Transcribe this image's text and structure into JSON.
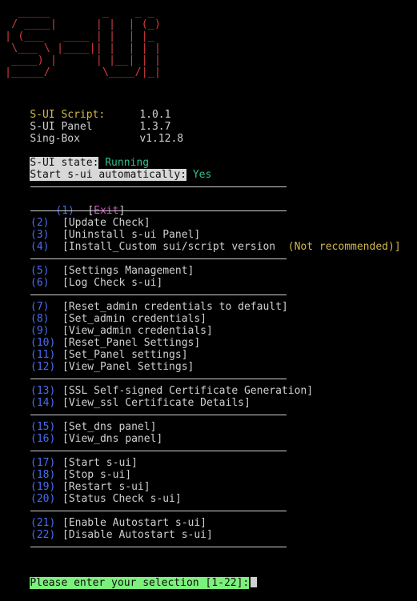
{
  "logo": {
    "lines": [
      "  _____        _    _ _ ",
      " / ____|      | |  | (_)",
      "| (___   ____ | |  | |_ ",
      " \\___ \\ |____|| |  | | |",
      " ____) |      | |__| | |",
      "|_____/        \\____/|_|"
    ]
  },
  "versions": [
    {
      "label": "S-UI Script:",
      "value": "1.0.1"
    },
    {
      "label": "S-UI Panel",
      "value": "1.3.7"
    },
    {
      "label": "Sing-Box",
      "value": "v1.12.8"
    }
  ],
  "status": {
    "state_label": "S-UI state:",
    "state_value": "Running",
    "auto_label": "Start s-ui automatically:",
    "auto_value": "Yes"
  },
  "menu": [
    {
      "num": "(1)",
      "label": "Exit",
      "exit": true
    },
    {
      "num": "(2)",
      "label": "[Update Check]"
    },
    {
      "num": "(3)",
      "label": "[Uninstall s-ui Panel]"
    },
    {
      "num": "(4)",
      "label": "[Install_Custom sui/script version",
      "note": "(Not recommended)]"
    },
    {
      "num": "(5)",
      "label": "[Settings Management]"
    },
    {
      "num": "(6)",
      "label": "[Log Check s-ui]"
    },
    {
      "num": "(7)",
      "label": "[Reset_admin credentials to default]"
    },
    {
      "num": "(8)",
      "label": "[Set_admin credentials]"
    },
    {
      "num": "(9)",
      "label": "[View_admin credentials]"
    },
    {
      "num": "(10)",
      "label": "[Reset_Panel Settings]"
    },
    {
      "num": "(11)",
      "label": "[Set_Panel settings]"
    },
    {
      "num": "(12)",
      "label": "[View_Panel Settings]"
    },
    {
      "num": "(13)",
      "label": "[SSL Self-signed Certificate Generation]"
    },
    {
      "num": "(14)",
      "label": "[View_ssl Certificate Details]"
    },
    {
      "num": "(15)",
      "label": "[Set_dns panel]"
    },
    {
      "num": "(16)",
      "label": "[View_dns panel]"
    },
    {
      "num": "(17)",
      "label": "[Start s-ui]"
    },
    {
      "num": "(18)",
      "label": "[Stop s-ui]"
    },
    {
      "num": "(19)",
      "label": "[Restart s-ui]"
    },
    {
      "num": "(20)",
      "label": "[Status Check s-ui]"
    },
    {
      "num": "(21)",
      "label": "[Enable Autostart s-ui]"
    },
    {
      "num": "(22)",
      "label": "[Disable Autostart s-ui]"
    }
  ],
  "prompt": "Please enter your selection [1-22]:"
}
